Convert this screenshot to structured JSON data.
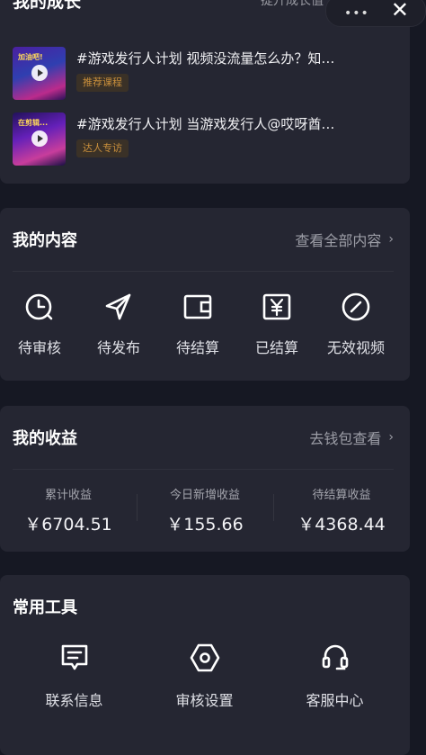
{
  "growth": {
    "title": "我的成长",
    "link": "提升成长值",
    "articles": [
      {
        "title": "#游戏发行人计划 视频没流量怎么办？知…",
        "tag": "推荐课程",
        "thumb_text": "加油吧!"
      },
      {
        "title": "#游戏发行人计划 当游戏发行人@哎呀酋…",
        "tag": "达人专访",
        "thumb_text": "在剪辑..."
      }
    ]
  },
  "content": {
    "title": "我的内容",
    "link": "查看全部内容",
    "items": [
      {
        "label": "待审核",
        "icon": "clock-icon"
      },
      {
        "label": "待发布",
        "icon": "send-icon"
      },
      {
        "label": "待结算",
        "icon": "wallet-icon"
      },
      {
        "label": "已结算",
        "icon": "yen-icon"
      },
      {
        "label": "无效视频",
        "icon": "invalid-icon"
      }
    ]
  },
  "income": {
    "title": "我的收益",
    "link": "去钱包查看",
    "stats": [
      {
        "label": "累计收益",
        "value": "￥6704.51"
      },
      {
        "label": "今日新增收益",
        "value": "￥155.66"
      },
      {
        "label": "待结算收益",
        "value": "￥4368.44"
      }
    ]
  },
  "tools": {
    "title": "常用工具",
    "items": [
      {
        "label": "联系信息",
        "icon": "message-icon"
      },
      {
        "label": "审核设置",
        "icon": "hexagon-icon"
      },
      {
        "label": "客服中心",
        "icon": "headset-icon"
      }
    ]
  },
  "colors": {
    "background": "#161823",
    "card": "#252632",
    "tag_text": "#c98f3c"
  }
}
